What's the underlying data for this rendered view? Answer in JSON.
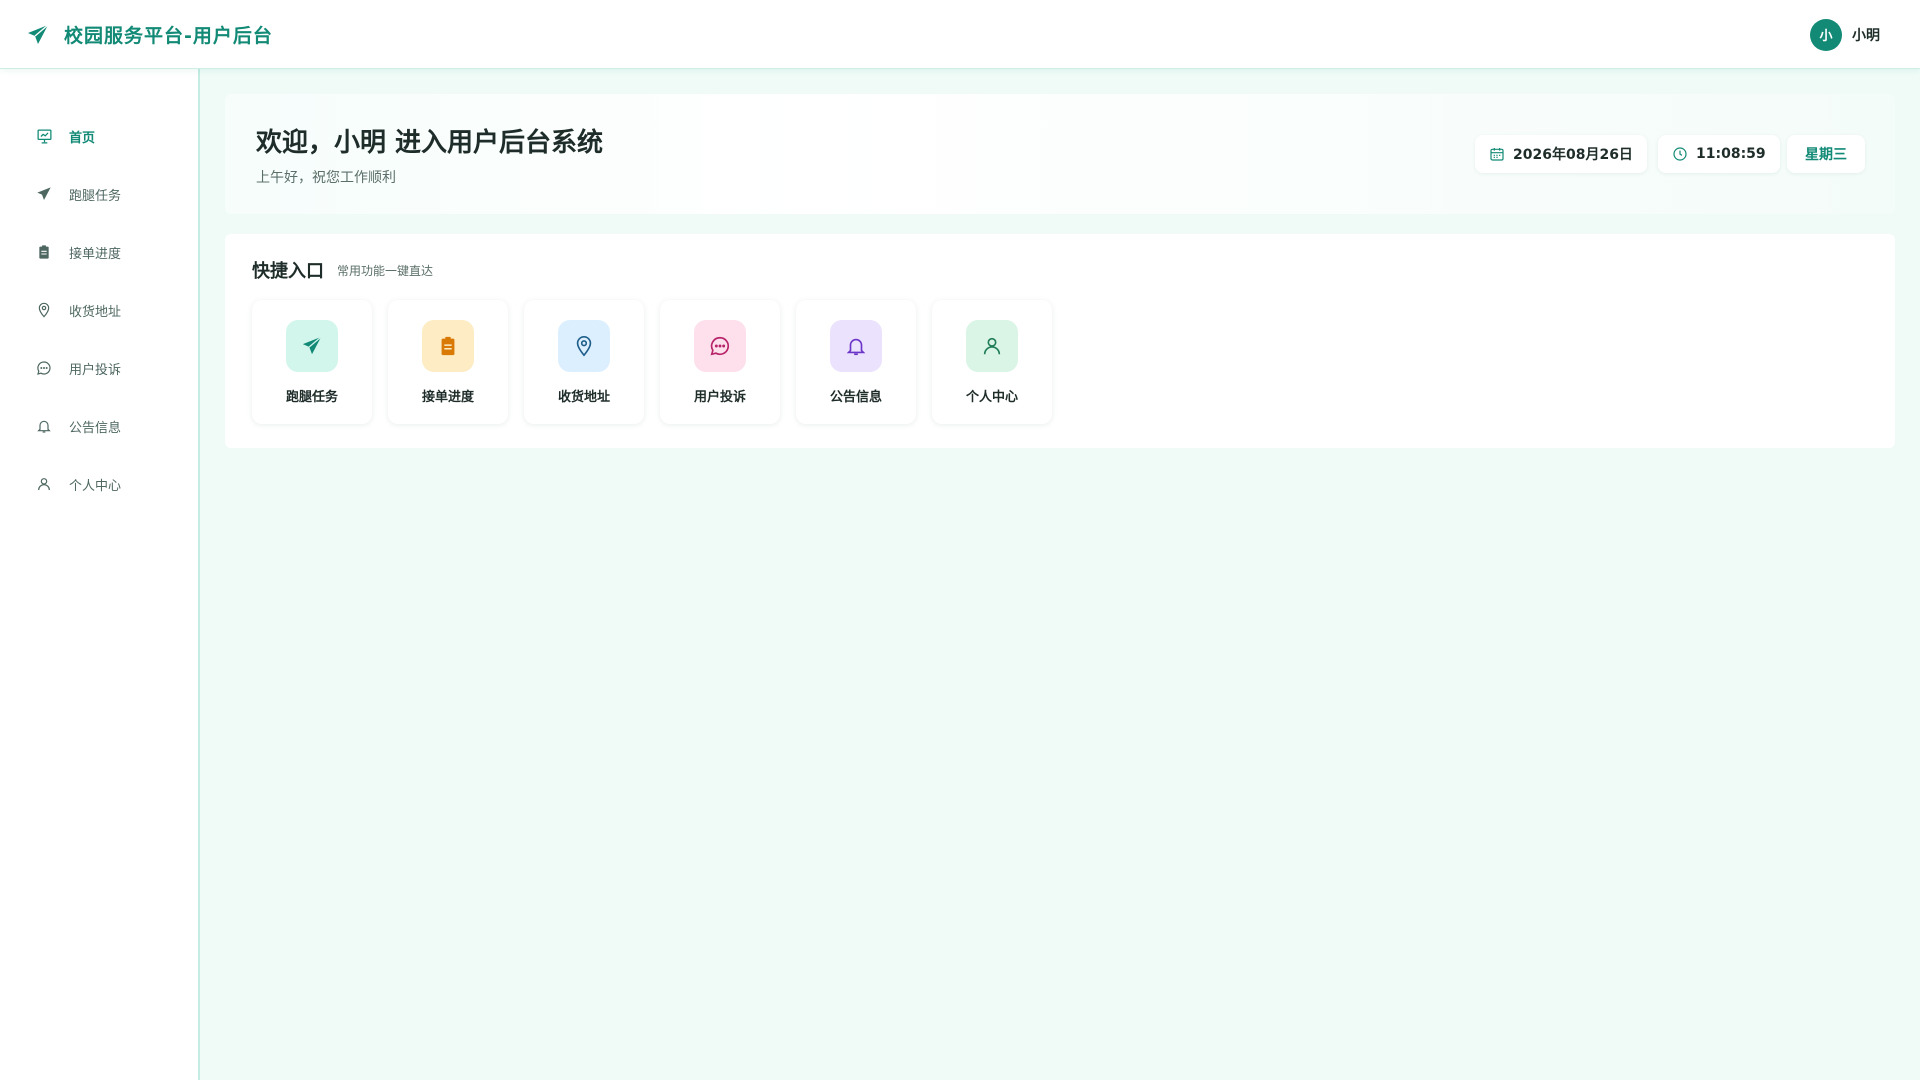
{
  "header": {
    "title": "校园服务平台-用户后台",
    "brand_icon": "paper-plane-icon",
    "avatar_text": "小",
    "user_name": "小明"
  },
  "colors": {
    "primary": "#128a76",
    "background": "#f0fbf8"
  },
  "sidebar": {
    "items": [
      {
        "label": "首页",
        "icon": "presentation-chart-icon",
        "active": true
      },
      {
        "label": "跑腿任务",
        "icon": "paper-plane-icon",
        "active": false
      },
      {
        "label": "接单进度",
        "icon": "clipboard-icon",
        "active": false
      },
      {
        "label": "收货地址",
        "icon": "location-pin-icon",
        "active": false
      },
      {
        "label": "用户投诉",
        "icon": "chat-bubble-icon",
        "active": false
      },
      {
        "label": "公告信息",
        "icon": "bell-icon",
        "active": false
      },
      {
        "label": "个人中心",
        "icon": "user-icon",
        "active": false
      }
    ]
  },
  "welcome": {
    "title": "欢迎，小明 进入用户后台系统",
    "subtitle": "上午好，祝您工作顺利",
    "date": "2026年08月26日",
    "time": "11:08:59",
    "weekday": "星期三"
  },
  "quick": {
    "title": "快捷入口",
    "subtitle": "常用功能一键直达",
    "tiles": [
      {
        "label": "跑腿任务",
        "icon": "paper-plane-icon",
        "bg": "#d3f6ec",
        "color": "#128a76"
      },
      {
        "label": "接单进度",
        "icon": "clipboard-icon",
        "bg": "#fdecc4",
        "color": "#d97a06"
      },
      {
        "label": "收货地址",
        "icon": "location-pin-icon",
        "bg": "#dcefff",
        "color": "#1f5f8a"
      },
      {
        "label": "用户投诉",
        "icon": "chat-bubble-icon",
        "bg": "#fde0ec",
        "color": "#b8246a"
      },
      {
        "label": "公告信息",
        "icon": "bell-icon",
        "bg": "#ebe2fd",
        "color": "#6b35c9"
      },
      {
        "label": "个人中心",
        "icon": "user-icon",
        "bg": "#daf5e6",
        "color": "#1f7d58"
      }
    ]
  }
}
